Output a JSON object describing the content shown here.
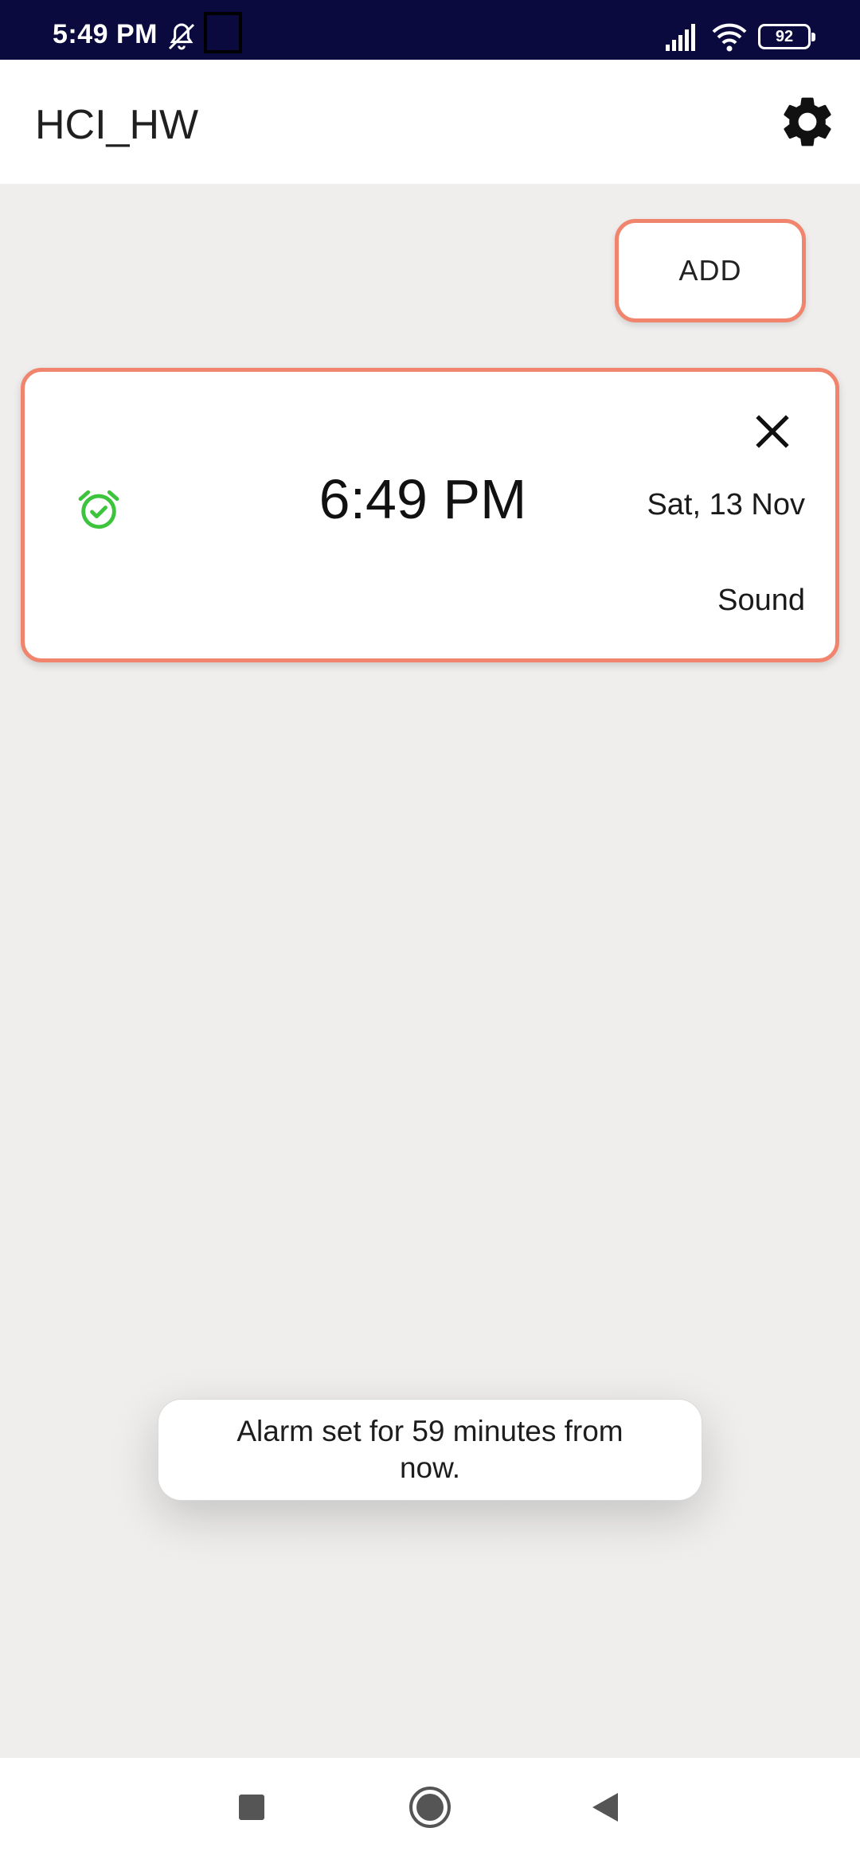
{
  "status_bar": {
    "time": "5:49 PM",
    "battery_level": "92",
    "icons": [
      "dnd-bell-off-icon",
      "notification-square-icon",
      "signal-icon",
      "wifi-icon",
      "battery-icon"
    ]
  },
  "app_bar": {
    "title": "HCI_HW",
    "settings_icon": "gear-icon"
  },
  "toolbar": {
    "add_label": "ADD"
  },
  "alarms": [
    {
      "time": "6:49 PM",
      "date": "Sat, 13 Nov",
      "sound": "Sound",
      "status_icon": "alarm-check-icon",
      "close_icon": "close-icon"
    }
  ],
  "toast": {
    "message": "Alarm set for 59 minutes from now."
  },
  "nav_bar": {
    "icons": [
      "recents-square-icon",
      "home-circle-icon",
      "back-triangle-icon"
    ]
  },
  "colors": {
    "status_bar_bg": "#0b0a3e",
    "accent_border": "#f0846d",
    "alarm_icon_green": "#3cc43c",
    "background": "#efeeed"
  }
}
